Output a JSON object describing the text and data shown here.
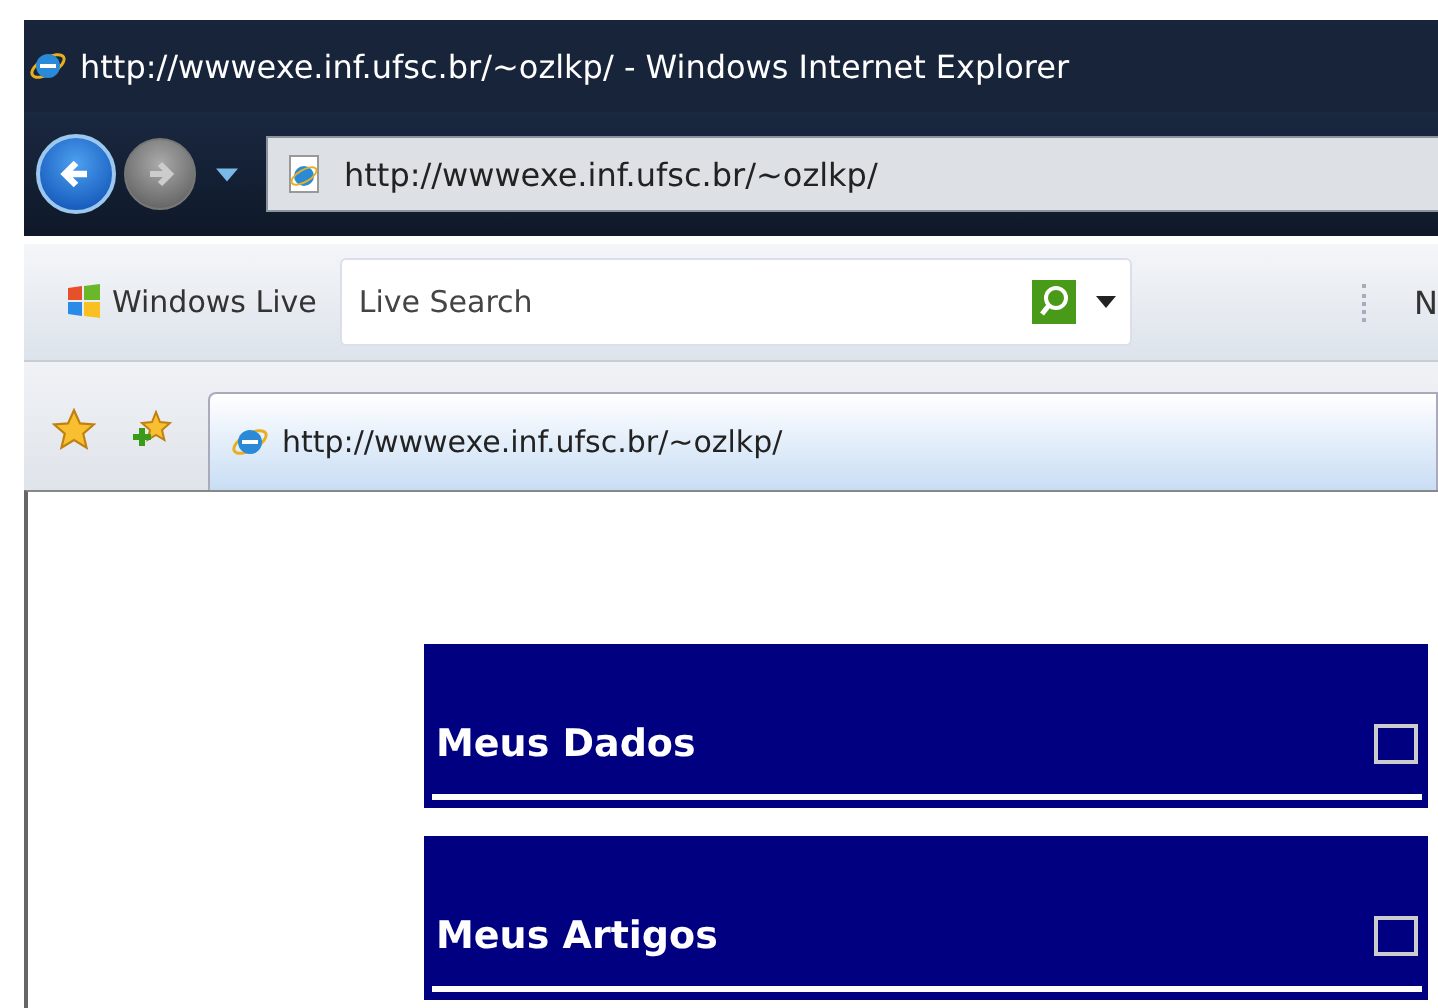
{
  "window": {
    "title": "http://wwwexe.inf.ufsc.br/~ozlkp/ - Windows Internet Explorer"
  },
  "address_bar": {
    "value": "http://wwwexe.inf.ufsc.br/~ozlkp/"
  },
  "toolbar": {
    "brand": "Windows Live",
    "search": {
      "placeholder": "Live Search"
    },
    "next_item": "N"
  },
  "tabs": [
    {
      "label": "http://wwwexe.inf.ufsc.br/~ozlkp/",
      "selected": true
    }
  ],
  "panels": [
    {
      "title": "Meus Dados",
      "checked": false
    },
    {
      "title": "Meus Artigos",
      "checked": false
    }
  ]
}
